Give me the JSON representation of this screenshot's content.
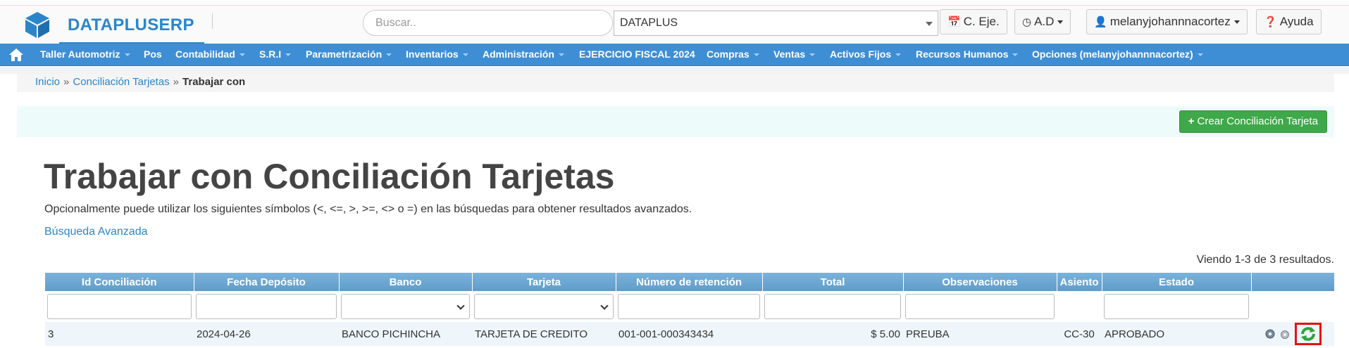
{
  "header": {
    "brand": "DATAPLUSERP",
    "search_placeholder": "Buscar..",
    "company_select": "DATAPLUS",
    "btn_ceje": "C. Eje.",
    "btn_ad": "A.D",
    "user": "melanyjohannnacortez",
    "help": "Ayuda"
  },
  "nav": {
    "items": [
      "Taller Automotriz",
      "Pos",
      "Contabilidad",
      "S.R.I",
      "Parametrización",
      "Inventarios",
      "Administración",
      "EJERCICIO FISCAL 2024",
      "Compras",
      "Ventas",
      "Activos Fijos",
      "Recursos Humanos",
      "Opciones (melanyjohannnacortez)"
    ]
  },
  "breadcrumb": {
    "home": "Inicio",
    "sep1": "»",
    "parent": "Conciliación Tarjetas",
    "sep2": "»",
    "current": "Trabajar con"
  },
  "actions": {
    "create": "Crear Conciliación Tarjeta"
  },
  "main": {
    "title": "Trabajar con Conciliación Tarjetas",
    "hint": "Opcionalmente puede utilizar los siguientes símbolos (<, <=, >, >=, <> o =) en las búsquedas para obtener resultados avanzados.",
    "advanced_link": "Búsqueda Avanzada",
    "summary": "Viendo 1-3 de 3 resultados."
  },
  "table": {
    "columns": [
      "Id Conciliación",
      "Fecha Depósito",
      "Banco",
      "Tarjeta",
      "Número de retención",
      "Total",
      "Observaciones",
      "Asiento",
      "Estado",
      ""
    ],
    "rows": [
      {
        "id": "3",
        "fecha": "2024-04-26",
        "banco": "BANCO PICHINCHA",
        "tarjeta": "TARJETA DE CREDITO",
        "retencion": "001-001-000343434",
        "total": "$ 5.00",
        "observaciones": "PREUBA",
        "asiento": "CC-30",
        "estado": "APROBADO"
      }
    ]
  },
  "colors": {
    "brand": "#2a86cb",
    "navbar": "#3e8ed5",
    "success": "#3fa84a",
    "table_header": "#6aa6d1",
    "highlight": "#e01414"
  }
}
